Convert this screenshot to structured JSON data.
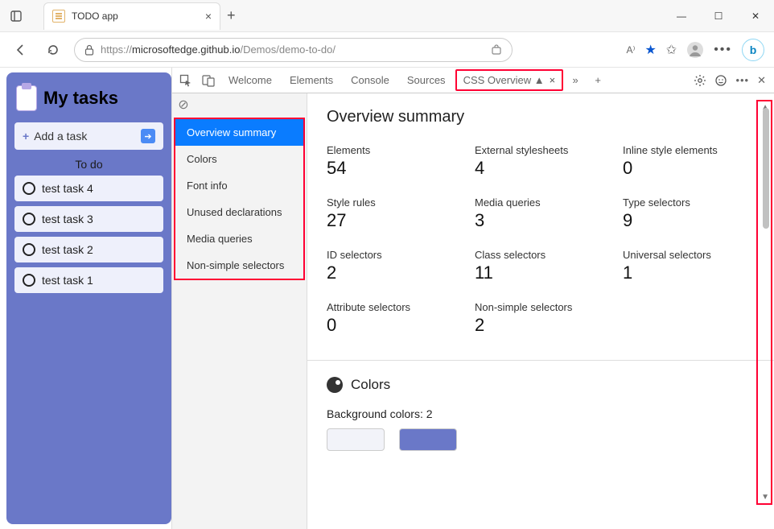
{
  "browser": {
    "tab_title": "TODO app",
    "url_host": "microsoftedge.github.io",
    "url_prefix": "https://",
    "url_path": "/Demos/demo-to-do/"
  },
  "app": {
    "title": "My tasks",
    "add_label": "Add a task",
    "section_label": "To do",
    "tasks": [
      "test task 4",
      "test task 3",
      "test task 2",
      "test task 1"
    ]
  },
  "devtools": {
    "tabs": [
      "Welcome",
      "Elements",
      "Console",
      "Sources",
      "CSS Overview ▲"
    ],
    "sidebar": [
      "Overview summary",
      "Colors",
      "Font info",
      "Unused declarations",
      "Media queries",
      "Non-simple selectors"
    ],
    "main_heading": "Overview summary",
    "stats": {
      "elements": {
        "label": "Elements",
        "value": "54"
      },
      "external_stylesheets": {
        "label": "External stylesheets",
        "value": "4"
      },
      "inline_style_elements": {
        "label": "Inline style elements",
        "value": "0"
      },
      "style_rules": {
        "label": "Style rules",
        "value": "27"
      },
      "media_queries": {
        "label": "Media queries",
        "value": "3"
      },
      "type_selectors": {
        "label": "Type selectors",
        "value": "9"
      },
      "id_selectors": {
        "label": "ID selectors",
        "value": "2"
      },
      "class_selectors": {
        "label": "Class selectors",
        "value": "11"
      },
      "universal_selectors": {
        "label": "Universal selectors",
        "value": "1"
      },
      "attribute_selectors": {
        "label": "Attribute selectors",
        "value": "0"
      },
      "non_simple_selectors": {
        "label": "Non-simple selectors",
        "value": "2"
      }
    },
    "colors_heading": "Colors",
    "bg_colors_label": "Background colors: 2",
    "swatches": [
      "#f2f3f9",
      "#6a78c8"
    ]
  }
}
